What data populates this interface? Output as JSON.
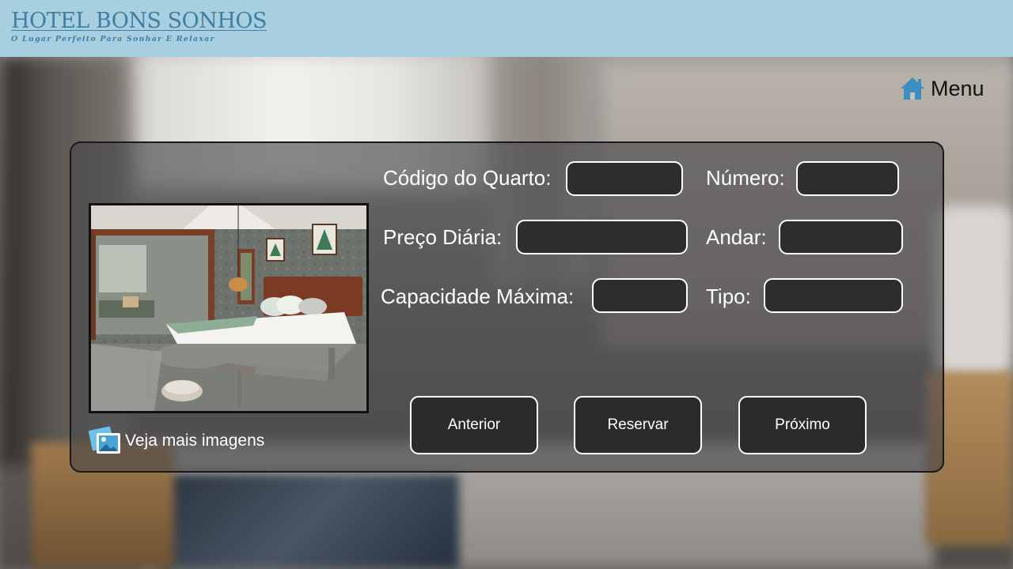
{
  "header": {
    "title": "HOTEL BONS SONHOS",
    "tagline": "O Lugar Perfeito Para Sonhar E Relaxar"
  },
  "menu": {
    "label": "Menu",
    "icon": "home-icon"
  },
  "room": {
    "fields": {
      "codigo": {
        "label": "Código do Quarto:",
        "value": ""
      },
      "numero": {
        "label": "Número:",
        "value": ""
      },
      "preco": {
        "label": "Preço Diária:",
        "value": ""
      },
      "andar": {
        "label": "Andar:",
        "value": ""
      },
      "capacidade": {
        "label": "Capacidade Máxima:",
        "value": ""
      },
      "tipo": {
        "label": "Tipo:",
        "value": ""
      }
    },
    "more_images": {
      "label": "Veja mais imagens",
      "icon": "images-icon"
    }
  },
  "actions": {
    "previous": "Anterior",
    "reserve": "Reservar",
    "next": "Próximo"
  },
  "colors": {
    "header_bg": "#a7cfdf",
    "brand": "#3f7fa3",
    "home_icon": "#3d8fc2"
  }
}
